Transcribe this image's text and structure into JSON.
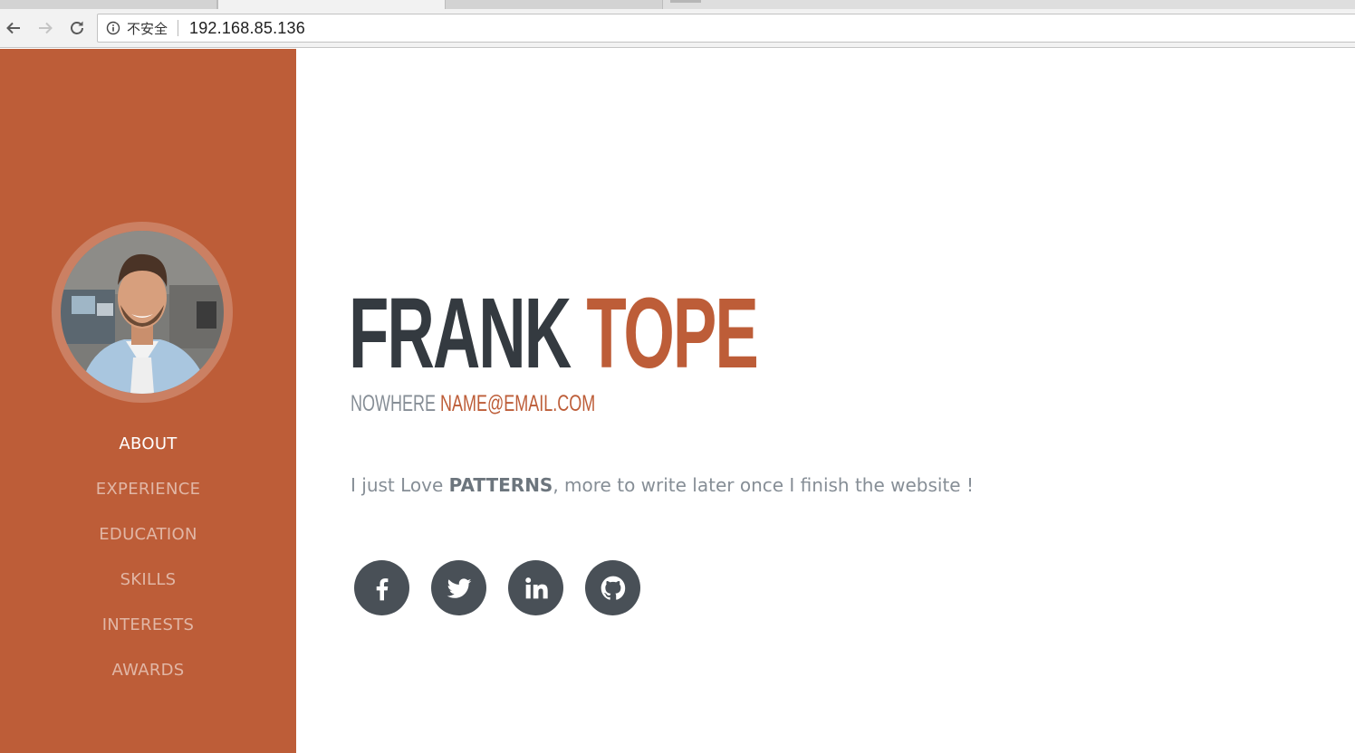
{
  "browser": {
    "security_label": "不安全",
    "url": "192.168.85.136",
    "nav": {
      "back_icon": "arrow-left-icon",
      "forward_icon": "arrow-right-icon",
      "reload_icon": "reload-icon"
    }
  },
  "sidebar": {
    "accent_color": "#bd5d38",
    "items": [
      {
        "label": "ABOUT",
        "active": true
      },
      {
        "label": "EXPERIENCE",
        "active": false
      },
      {
        "label": "EDUCATION",
        "active": false
      },
      {
        "label": "SKILLS",
        "active": false
      },
      {
        "label": "INTERESTS",
        "active": false
      },
      {
        "label": "AWARDS",
        "active": false
      }
    ]
  },
  "about": {
    "first_name": "FRANK",
    "last_name": "TOPE",
    "address": "NOWHERE",
    "email": "NAME@EMAIL.COM",
    "lead_prefix": "I just Love ",
    "lead_bold": "PATTERNS",
    "lead_suffix": ", more to write later once I finish the website !",
    "social": [
      "facebook-icon",
      "twitter-icon",
      "linkedin-icon",
      "github-icon"
    ]
  }
}
